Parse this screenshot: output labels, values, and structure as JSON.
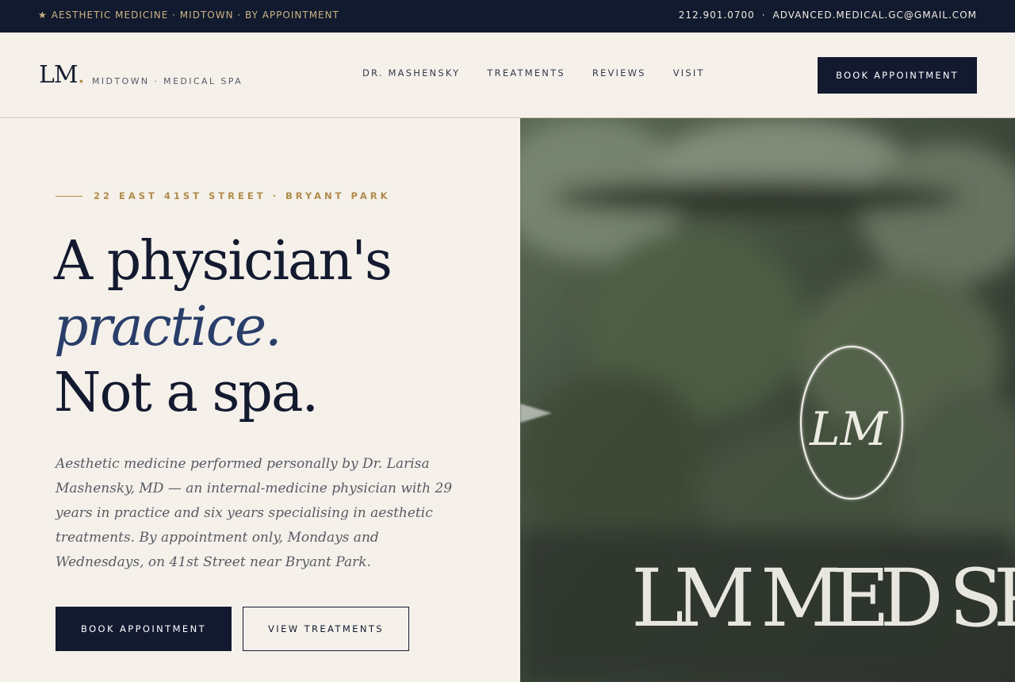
{
  "topbar": {
    "star_icon": "★",
    "tagline": "AESTHETIC MEDICINE · MIDTOWN · BY APPOINTMENT",
    "phone": "212.901.0700",
    "separator": "·",
    "email": "ADVANCED.MEDICAL.GC@GMAIL.COM"
  },
  "header": {
    "logo_letters": "LM",
    "logo_dot": ".",
    "logo_subtitle": "MIDTOWN · MEDICAL SPA",
    "nav": [
      {
        "label": "DR. MASHENSKY"
      },
      {
        "label": "TREATMENTS"
      },
      {
        "label": "REVIEWS"
      },
      {
        "label": "VISIT"
      }
    ],
    "cta_label": "BOOK APPOINTMENT"
  },
  "hero": {
    "eyebrow": "22 EAST 41ST STREET · BRYANT PARK",
    "headline_line1": "A physician's",
    "headline_line2": "practice.",
    "headline_line3": "Not a spa.",
    "lede": "Aesthetic medicine performed personally by Dr. Larisa Mashensky, MD — an internal-medicine physician with 29 years in practice and six years specialising in aesthetic treatments. By appointment only, Mondays and Wednesdays, on 41st Street near Bryant Park.",
    "primary_button": "BOOK APPOINTMENT",
    "secondary_button": "VIEW TREATMENTS"
  },
  "image": {
    "monogram": "LM",
    "sign_text": "LM MED SP"
  },
  "colors": {
    "navy": "#131a30",
    "gold": "#b08a4c",
    "cream": "#f5f1ea",
    "accent_blue": "#2a3e6a"
  }
}
